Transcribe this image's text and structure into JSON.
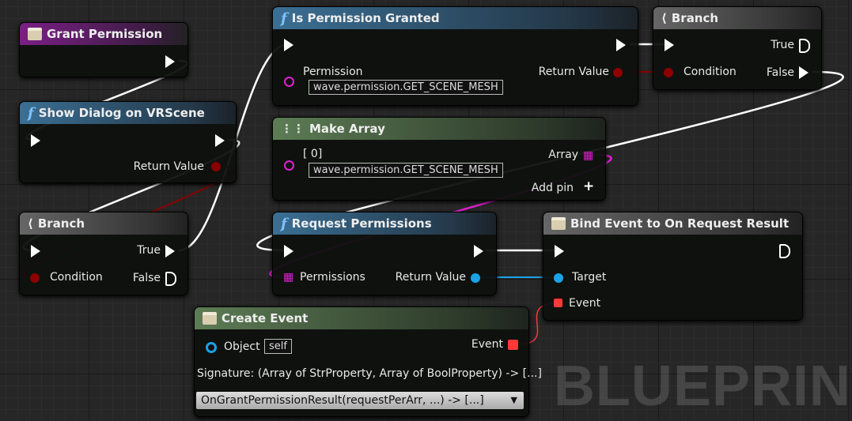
{
  "watermark": "BLUEPRINT",
  "nodes": {
    "grant": {
      "title": "Grant Permission"
    },
    "show": {
      "title": "Show Dialog on VRScene",
      "return": "Return Value"
    },
    "branch1": {
      "title": "Branch",
      "true": "True",
      "false": "False",
      "condition": "Condition"
    },
    "isperm": {
      "title": "Is Permission Granted",
      "param": "Permission",
      "value": "wave.permission.GET_SCENE_MESH",
      "return": "Return Value"
    },
    "branch2": {
      "title": "Branch",
      "true": "True",
      "false": "False",
      "condition": "Condition"
    },
    "makearr": {
      "title": "Make Array",
      "index": "[ 0]",
      "value": "wave.permission.GET_SCENE_MESH",
      "array": "Array",
      "addpin": "Add pin"
    },
    "request": {
      "title": "Request Permissions",
      "param": "Permissions",
      "return": "Return Value"
    },
    "bind": {
      "title": "Bind Event to On Request Result",
      "target": "Target",
      "event": "Event"
    },
    "create": {
      "title": "Create Event",
      "object": "Object",
      "self": "self",
      "event": "Event",
      "signature": "Signature: (Array of StrProperty, Array of BoolProperty) -> [...]",
      "selected": "OnGrantPermissionResult(requestPerArr, ...) -> [...]"
    }
  },
  "colors": {
    "exec": "#ffffff",
    "bool": "#8c0000",
    "array": "#e020d0",
    "object": "#1aa3e8",
    "delegate": "#ff3838"
  }
}
